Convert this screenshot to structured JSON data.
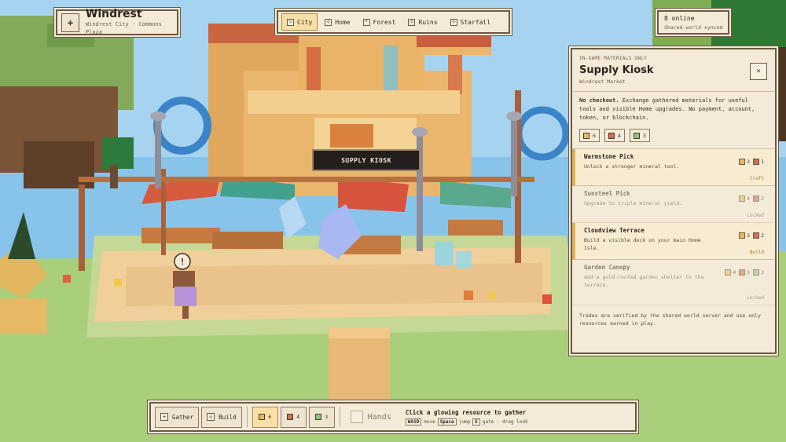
{
  "location": {
    "icon": "compass-icon",
    "title": "Windrest",
    "subtitle": "Windrest City · Commons Plaza"
  },
  "zones": [
    {
      "label": "City",
      "icon": "city-icon",
      "active": true
    },
    {
      "label": "Home",
      "icon": "home-icon",
      "active": false
    },
    {
      "label": "Forest",
      "icon": "tree-icon",
      "active": false
    },
    {
      "label": "Ruins",
      "icon": "ruins-icon",
      "active": false
    },
    {
      "label": "Starfall",
      "icon": "star-icon",
      "active": false
    }
  ],
  "online": {
    "count": "8 online",
    "status": "Shared world synced"
  },
  "world": {
    "kiosk_sign": "SUPPLY KIOSK"
  },
  "shop": {
    "eyebrow": "IN-GAME MATERIALS ONLY",
    "title": "Supply Kiosk",
    "subtitle": "Windrest Market",
    "close_glyph": "×",
    "desc_bold": "No checkout.",
    "desc": "Exchange gathered materials for useful tools and visible Home upgrades. No payment, account, token, or blockchain.",
    "resources": [
      {
        "count": "6",
        "color": "#e5b95f"
      },
      {
        "count": "4",
        "color": "#c77155"
      },
      {
        "count": "3",
        "color": "#8fbf84"
      }
    ],
    "offers": [
      {
        "name": "Warmstone Pick",
        "desc": "Unlock a stronger mineral tool.",
        "cost": [
          {
            "color": "#e5b95f",
            "n": "2"
          },
          {
            "color": "#c77155",
            "n": "1"
          }
        ],
        "state": "Craft",
        "available": true
      },
      {
        "name": "Sunsteel Pick",
        "desc": "Upgrade to triple mineral yield.",
        "cost": [
          {
            "color": "#e5b95f",
            "n": "4"
          },
          {
            "color": "#c77155",
            "n": "2"
          }
        ],
        "state": "Locked",
        "available": false
      },
      {
        "name": "Cloudview Terrace",
        "desc": "Build a visible deck on your main Home Isle.",
        "cost": [
          {
            "color": "#e5b95f",
            "n": "3"
          },
          {
            "color": "#c77155",
            "n": "2"
          }
        ],
        "state": "Build",
        "available": true
      },
      {
        "name": "Garden Canopy",
        "desc": "Add a gold-roofed garden shelter to the terrace.",
        "cost": [
          {
            "color": "#e5b95f",
            "n": "4"
          },
          {
            "color": "#c77155",
            "n": "3"
          },
          {
            "color": "#8fbf84",
            "n": "3"
          }
        ],
        "state": "Locked",
        "available": false
      }
    ],
    "footer": "Trades are verified by the shared world server and use only resources earned in play."
  },
  "hotbar": {
    "gather": {
      "label": "Gather",
      "icon": "hand-icon"
    },
    "build": {
      "label": "Build",
      "icon": "build-icon"
    },
    "resources": [
      {
        "count": "6",
        "color": "#e5b95f",
        "selected": true
      },
      {
        "count": "4",
        "color": "#c77155",
        "selected": false
      },
      {
        "count": "3",
        "color": "#8fbf84",
        "selected": false
      }
    ],
    "hands_label": "Hands",
    "hint": "Click a glowing resource to gather",
    "keys": [
      {
        "key": "WASD",
        "action": "move"
      },
      {
        "key": "Space",
        "action": "jump"
      },
      {
        "key": "E",
        "action": "gate · drag look"
      }
    ]
  }
}
